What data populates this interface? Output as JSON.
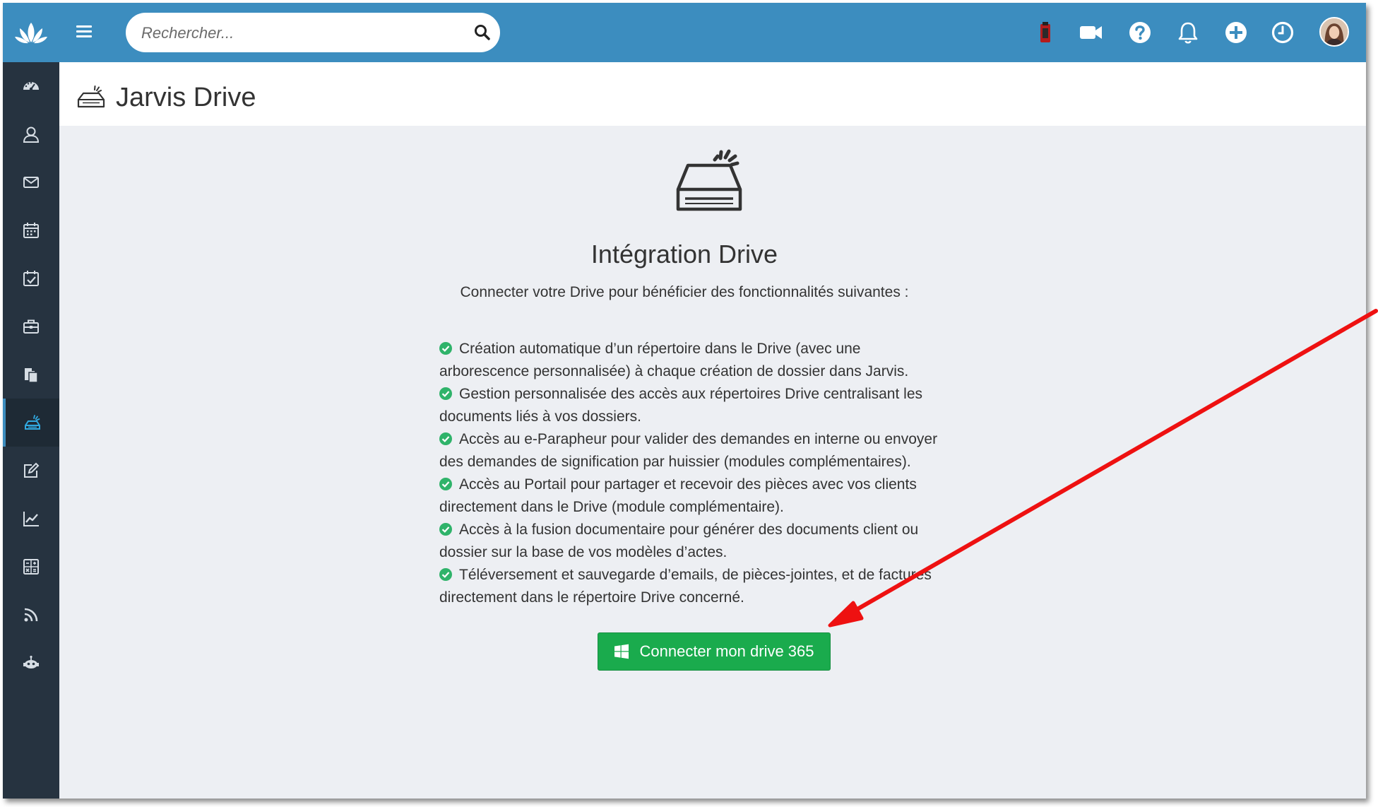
{
  "search": {
    "placeholder": "Rechercher..."
  },
  "topbar": {
    "icons": [
      "extension-icon",
      "video-camera-icon",
      "help-icon",
      "bell-icon",
      "add-icon",
      "clock-icon"
    ]
  },
  "sidebar": {
    "items": [
      {
        "icon": "dashboard-icon"
      },
      {
        "icon": "contacts-icon"
      },
      {
        "icon": "mail-icon"
      },
      {
        "icon": "calendar-icon"
      },
      {
        "icon": "tasks-icon"
      },
      {
        "icon": "briefcase-icon"
      },
      {
        "icon": "documents-icon"
      },
      {
        "icon": "drive-icon",
        "active": true
      },
      {
        "icon": "edit-icon"
      },
      {
        "icon": "chart-icon"
      },
      {
        "icon": "calculator-icon"
      },
      {
        "icon": "rss-icon"
      },
      {
        "icon": "robot-icon"
      }
    ]
  },
  "header": {
    "title": "Jarvis Drive"
  },
  "main": {
    "title": "Intégration Drive",
    "subtitle": "Connecter votre Drive pour bénéficier des fonctionnalités suivantes :",
    "features": [
      {
        "first": "Création automatique d’un répertoire dans le Drive (avec une",
        "rest": "arborescence personnalisée) à chaque création de dossier dans Jarvis."
      },
      {
        "first": "Gestion personnalisée des accès aux répertoires Drive centralisant les",
        "rest": "documents liés à vos dossiers."
      },
      {
        "first": "Accès au e-Parapheur pour valider des demandes en interne ou envoyer",
        "rest": "des demandes de signification par huissier (modules complémentaires)."
      },
      {
        "first": "Accès au Portail pour partager et recevoir des pièces avec vos clients",
        "rest": "directement dans le Drive (module complémentaire)."
      },
      {
        "first": "Accès à la fusion documentaire pour générer des documents client ou",
        "rest": "dossier sur la base de vos modèles d’actes."
      },
      {
        "first": "Téléversement et sauvegarde d’emails, de pièces-jointes, et de factures",
        "rest": "directement dans le répertoire Drive concerné."
      }
    ],
    "connect_button": "Connecter mon drive 365"
  },
  "colors": {
    "topbar": "#3c8dbf",
    "sidebar": "#263340",
    "content_bg": "#edeff3",
    "button": "#1aab4d",
    "check": "#2fb36a",
    "arrow": "#ee1111"
  }
}
